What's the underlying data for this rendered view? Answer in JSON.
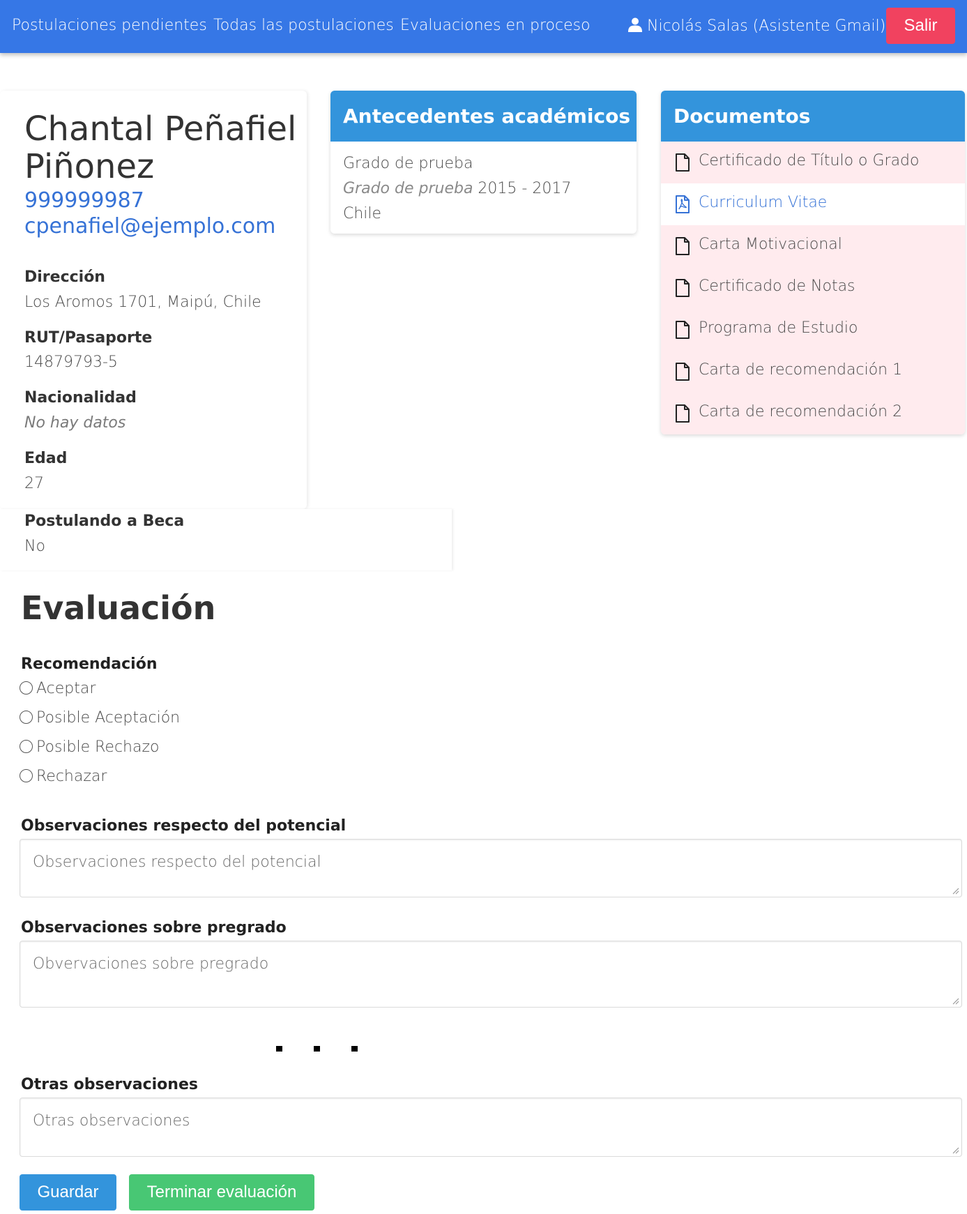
{
  "navbar": {
    "links": [
      "Postulaciones pendientes",
      "Todas las postulaciones",
      "Evaluaciones en proceso"
    ],
    "user_label": "Nicolás Salas (Asistente Gmail)",
    "logout_label": "Salir"
  },
  "candidate": {
    "name": "Chantal Peñafiel Piñonez",
    "phone": "999999987",
    "email": "cpenafiel@ejemplo.com",
    "fields": [
      {
        "label": "Dirección",
        "value": "Los Aromos 1701, Maipú, Chile",
        "empty": false
      },
      {
        "label": "RUT/Pasaporte",
        "value": "14879793-5",
        "empty": false
      },
      {
        "label": "Nacionalidad",
        "value": "No hay datos",
        "empty": true
      },
      {
        "label": "Edad",
        "value": "27",
        "empty": false
      },
      {
        "label": "Postulando a Beca",
        "value": "No",
        "empty": false
      }
    ]
  },
  "academic": {
    "title": "Antecedentes académicos",
    "degree": "Grado de prueba",
    "degree_italic": "Grado de prueba",
    "years": "2015 - 2017",
    "country": "Chile"
  },
  "documents": {
    "title": "Documentos",
    "items": [
      {
        "label": "Certificado de Título o Grado",
        "uploaded": false
      },
      {
        "label": "Curriculum Vitae",
        "uploaded": true
      },
      {
        "label": "Carta Motivacional",
        "uploaded": false
      },
      {
        "label": "Certificado de Notas",
        "uploaded": false
      },
      {
        "label": "Programa de Estudio",
        "uploaded": false
      },
      {
        "label": "Carta de recomendación 1",
        "uploaded": false
      },
      {
        "label": "Carta de recomendación 2",
        "uploaded": false
      }
    ]
  },
  "evaluation": {
    "title": "Evaluación",
    "recommendation_label": "Recomendación",
    "options": [
      "Aceptar",
      "Posible Aceptación",
      "Posible Rechazo",
      "Rechazar"
    ],
    "potential_label": "Observaciones respecto del potencial",
    "potential_placeholder": "Observaciones respecto del potencial",
    "undergrad_label": "Observaciones sobre pregrado",
    "undergrad_placeholder": "Obvervaciones sobre pregrado",
    "other_label": "Otras observaciones",
    "other_placeholder": "Otras observaciones",
    "save_label": "Guardar",
    "finish_label": "Terminar evaluación"
  },
  "colors": {
    "navbar": "#3677e6",
    "card_header": "#3394dc",
    "missing_doc_bg": "#ffebee",
    "logout": "#f1425f",
    "save": "#3394dc",
    "finish": "#48c774",
    "link": "#3672d6"
  }
}
